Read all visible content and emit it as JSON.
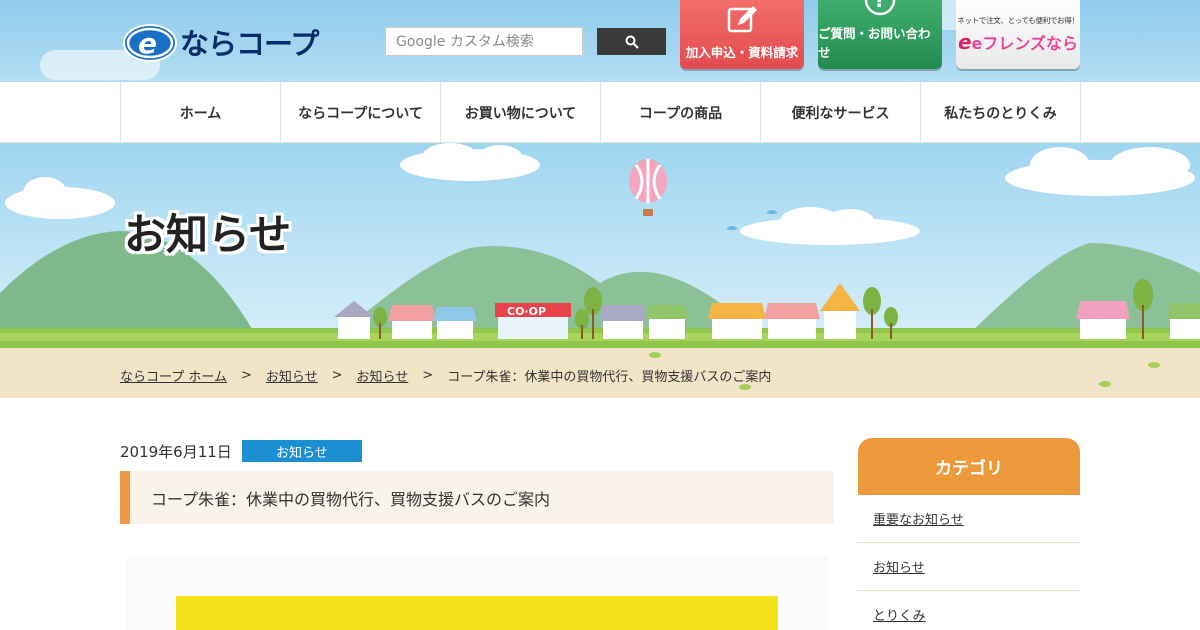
{
  "header": {
    "logo_text": "ならコープ",
    "search": {
      "placeholder": "Google カスタム検索",
      "button_icon": "search-icon"
    },
    "buttons": [
      {
        "label": "加入申込・資料請求",
        "icon": "edit-icon",
        "color": "#e24b4f"
      },
      {
        "label": "ご質問・お問い合わせ",
        "icon": "question-icon",
        "color": "#248a4f"
      }
    ],
    "friends_banner": {
      "small": "ネットで注文、とっても便利でお得！",
      "main": "eフレンズなら"
    }
  },
  "nav": {
    "items": [
      {
        "label": "ホーム"
      },
      {
        "label": "ならコープについて"
      },
      {
        "label": "お買い物について"
      },
      {
        "label": "コープの商品"
      },
      {
        "label": "便利なサービス"
      },
      {
        "label": "私たちのとりくみ"
      }
    ]
  },
  "hero": {
    "title": "お知らせ",
    "store_sign": "CO·OP"
  },
  "breadcrumb": {
    "items": [
      {
        "label": "ならコープ ホーム"
      },
      {
        "label": "お知らせ"
      },
      {
        "label": "お知らせ"
      }
    ],
    "current": "コープ朱雀：休業中の買物代行、買物支援バスのご案内",
    "separator": ">"
  },
  "post": {
    "date": "2019年6月11日",
    "category_badge": "お知らせ",
    "title": "コープ朱雀：休業中の買物代行、買物支援バスのご案内"
  },
  "sidebar": {
    "heading": "カテゴリ",
    "items": [
      {
        "label": "重要なお知らせ"
      },
      {
        "label": "お知らせ"
      },
      {
        "label": "とりくみ"
      }
    ]
  },
  "colors": {
    "brand_navy": "#0a2c6b",
    "badge_blue": "#1b8fd2",
    "accent_orange": "#ec9a3c"
  }
}
